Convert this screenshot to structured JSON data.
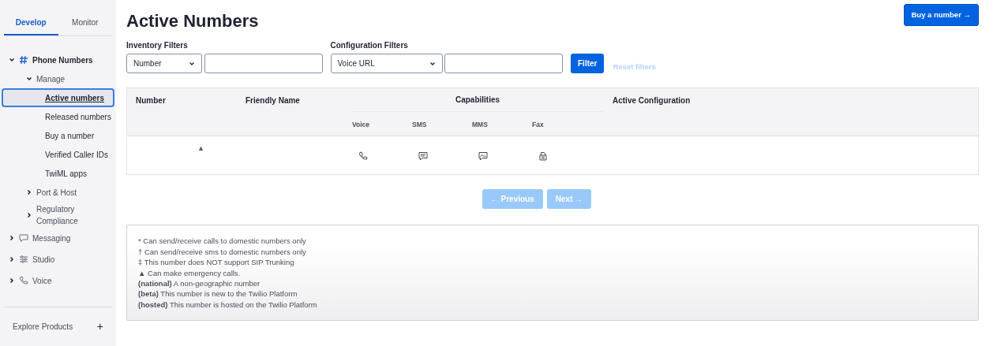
{
  "sidebar": {
    "tabs": [
      {
        "label": "Develop",
        "selected": true
      },
      {
        "label": "Monitor",
        "selected": false
      }
    ],
    "nav": [
      {
        "label": "Phone Numbers",
        "kind": "hash",
        "expanded": true,
        "children": [
          {
            "label": "Manage",
            "expanded": true,
            "children": [
              {
                "label": "Active numbers",
                "selected": true
              },
              {
                "label": "Released numbers",
                "selected": false
              },
              {
                "label": "Buy a number",
                "selected": false
              },
              {
                "label": "Verified Caller IDs",
                "selected": false
              },
              {
                "label": "TwiML apps",
                "selected": false
              }
            ]
          },
          {
            "label": "Port & Host",
            "expanded": false
          },
          {
            "label": "Regulatory Compliance",
            "expanded": false
          }
        ]
      },
      {
        "label": "Messaging",
        "kind": "chat",
        "expanded": false
      },
      {
        "label": "Studio",
        "kind": "studio",
        "expanded": false
      },
      {
        "label": "Voice",
        "kind": "phone",
        "expanded": false
      }
    ],
    "footer": {
      "label": "Explore Products",
      "action": "+"
    }
  },
  "title": "Active Numbers",
  "buy_button": "Buy a number →",
  "filters": [
    {
      "label": "Inventory Filters",
      "select": "Number"
    },
    {
      "label": "Configuration Filters",
      "select": "Voice URL"
    }
  ],
  "filter_button": "Filter",
  "reset_button": {
    "label": "Reset filters",
    "disabled": true
  },
  "table": {
    "columns": [
      "Number",
      "Friendly Name",
      "Capabilities",
      "Active Configuration"
    ],
    "capability_columns": [
      "Voice",
      "SMS",
      "MMS",
      "Fax"
    ],
    "rows": [
      {
        "number": "▲",
        "capabilities": [
          true,
          true,
          true,
          true
        ]
      }
    ]
  },
  "pagination": [
    {
      "label": "← Previous",
      "disabled": true
    },
    {
      "label": "Next →",
      "disabled": true
    }
  ],
  "legend": [
    "* Can send/receive calls to domestic numbers only",
    "† Can send/receive sms to domestic numbers only",
    "‡ This number does NOT support SIP Trunking",
    "▲ Can make emergency calls.",
    "**(national)** A non-geographic number",
    "**(beta)** This number is new to the Twilio Platform",
    "**(hosted)** This number is hosted on the Twilio Platform"
  ]
}
